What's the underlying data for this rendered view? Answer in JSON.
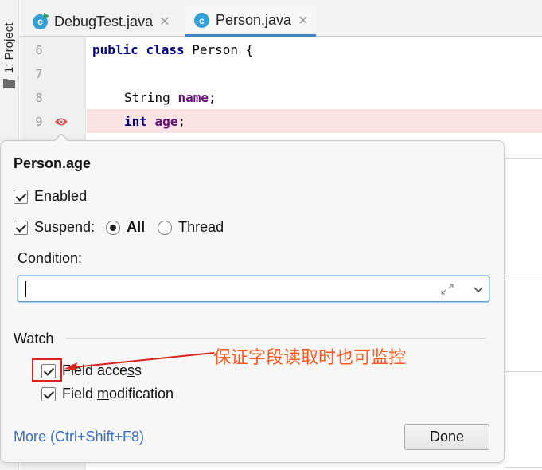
{
  "side_panel": {
    "project_tab_label": "1: Project"
  },
  "tabs": [
    {
      "label": "DebugTest.java",
      "icon": "c",
      "close": "✕"
    },
    {
      "label": "Person.java",
      "icon": "c",
      "close": "✕"
    }
  ],
  "gutter": {
    "line_numbers": [
      "6",
      "7",
      "8",
      "9"
    ]
  },
  "editor": {
    "line6": {
      "kw1": "public",
      "kw2": "class",
      "rest": " Person {"
    },
    "line8": {
      "type": "String ",
      "field": "name",
      "end": ";"
    },
    "line9": {
      "kw": "int",
      "field": "age",
      "end": ";"
    }
  },
  "breakpoint_popup": {
    "title": "Person.age",
    "enabled": {
      "pre": "Enable",
      "u": "d",
      "post": "",
      "checked": true
    },
    "suspend": {
      "pre": "",
      "u": "S",
      "post": "uspend:",
      "checked": true
    },
    "suspend_all": {
      "u": "A",
      "post": "ll",
      "selected": true
    },
    "suspend_thread": {
      "u": "T",
      "post": "hread",
      "selected": false
    },
    "condition_label": {
      "u": "C",
      "post": "ondition:"
    },
    "condition_value": "",
    "watch_label": "Watch",
    "field_access": {
      "pre": "Field acce",
      "u": "s",
      "post": "s",
      "checked": true
    },
    "field_modification": {
      "pre": "Field ",
      "u": "m",
      "post": "odification",
      "checked": true
    },
    "more_link": "More (Ctrl+Shift+F8)",
    "done_button": "Done"
  },
  "annotation": {
    "text": "保证字段读取时也可监控",
    "color": "#ff5a1f"
  },
  "colors": {
    "accent": "#4083c9",
    "breakpoint_line": "#fbe3e4",
    "keyword": "#000080",
    "field": "#660e7a",
    "highlight_box": "#d9231c"
  }
}
